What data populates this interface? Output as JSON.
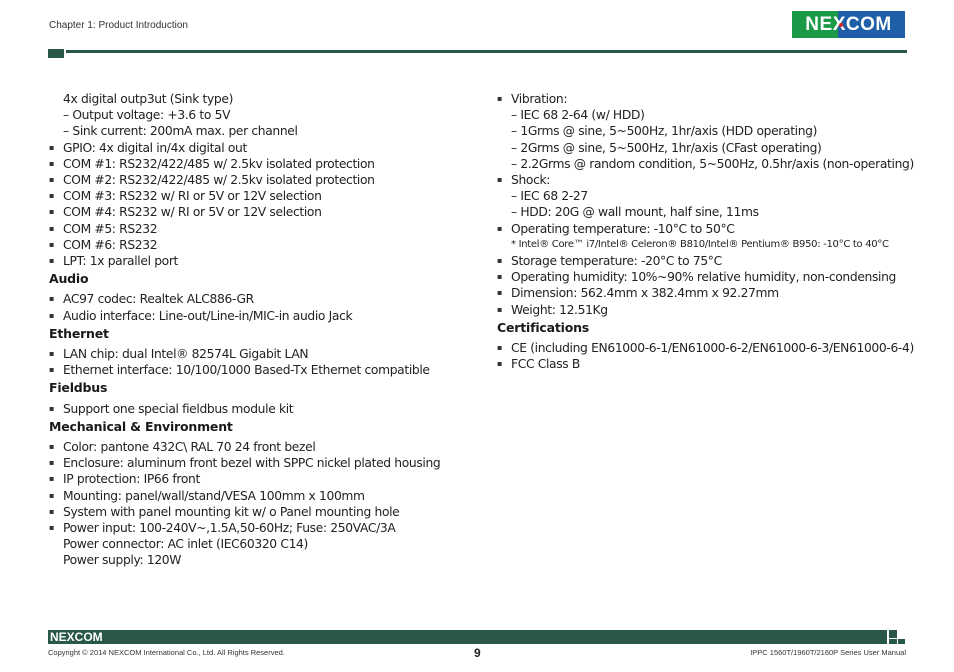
{
  "header": {
    "chapter": "Chapter 1: Product Introduction",
    "logo_text": "NEXCOM",
    "brand_colors": {
      "green": "#1a9a47",
      "blue": "#1f5fa8",
      "dark_green": "#2a5848",
      "red": "#e3262b"
    }
  },
  "left_column": {
    "io_lines": [
      {
        "type": "plain",
        "text": "4x digital outp3ut (Sink type)"
      },
      {
        "type": "dash",
        "text": "– Output voltage: +3.6 to 5V"
      },
      {
        "type": "dash",
        "text": "– Sink current: 200mA max. per channel"
      },
      {
        "type": "bullet",
        "text": "GPIO: 4x digital in/4x digital out"
      },
      {
        "type": "bullet",
        "text": "COM #1: RS232/422/485 w/ 2.5kv isolated protection"
      },
      {
        "type": "bullet",
        "text": "COM #2: RS232/422/485 w/ 2.5kv isolated protection"
      },
      {
        "type": "bullet",
        "text": "COM #3: RS232 w/ RI or 5V or 12V selection"
      },
      {
        "type": "bullet",
        "text": "COM #4: RS232 w/ RI or 5V or 12V selection"
      },
      {
        "type": "bullet",
        "text": "COM #5: RS232"
      },
      {
        "type": "bullet",
        "text": "COM #6: RS232"
      },
      {
        "type": "bullet",
        "text": "LPT: 1x parallel port"
      }
    ],
    "audio": {
      "heading": "Audio",
      "items": [
        "AC97 codec: Realtek ALC886-GR",
        "Audio interface: Line-out/Line-in/MIC-in audio Jack"
      ]
    },
    "ethernet": {
      "heading": "Ethernet",
      "items": [
        "LAN chip: dual Intel® 82574L Gigabit LAN",
        "Ethernet interface: 10/100/1000 Based-Tx Ethernet compatible"
      ]
    },
    "fieldbus": {
      "heading": "Fieldbus",
      "items": [
        "Support one special fieldbus module kit"
      ]
    },
    "mechanical": {
      "heading": "Mechanical & Environment",
      "items": [
        "Color: pantone 432C\\ RAL 70 24 front bezel",
        "Enclosure: aluminum front bezel with SPPC nickel plated housing",
        "IP protection: IP66 front",
        "Mounting: panel/wall/stand/VESA 100mm x 100mm",
        "System with panel mounting kit w/ o Panel mounting hole",
        "Power input: 100-240V~,1.5A,50-60Hz; Fuse: 250VAC/3A"
      ],
      "continuation": [
        "Power connector: AC inlet (IEC60320 C14)",
        "Power supply: 120W"
      ]
    }
  },
  "right_column": {
    "env_lines": [
      {
        "type": "bullet",
        "text": "Vibration:"
      },
      {
        "type": "dash",
        "text": "– IEC 68 2-64 (w/ HDD)"
      },
      {
        "type": "dash",
        "text": "– 1Grms @ sine, 5~500Hz, 1hr/axis (HDD operating)"
      },
      {
        "type": "dash",
        "text": "– 2Grms @ sine, 5~500Hz, 1hr/axis (CFast operating)"
      },
      {
        "type": "dash",
        "text": "– 2.2Grms @ random condition, 5~500Hz, 0.5hr/axis (non-operating)"
      },
      {
        "type": "bullet",
        "text": "Shock:"
      },
      {
        "type": "dash",
        "text": "– IEC 68 2-27"
      },
      {
        "type": "dash",
        "text": "– HDD: 20G @ wall mount, half sine, 11ms"
      },
      {
        "type": "bullet",
        "text": "Operating temperature: -10°C to 50°C"
      },
      {
        "type": "note",
        "text": "* Intel® Core™ i7/Intel® Celeron® B810/Intel® Pentium® B950: -10°C to 40°C"
      },
      {
        "type": "bullet",
        "text": "Storage temperature: -20°C to 75°C"
      },
      {
        "type": "bullet",
        "text": "Operating humidity: 10%~90% relative humidity, non-condensing"
      },
      {
        "type": "bullet",
        "text": "Dimension: 562.4mm x 382.4mm x 92.27mm"
      },
      {
        "type": "bullet",
        "text": "Weight: 12.51Kg"
      }
    ],
    "certifications": {
      "heading": "Certifications",
      "items": [
        "CE (including EN61000-6-1/EN61000-6-2/EN61000-6-3/EN61000-6-4)",
        "FCC Class B"
      ]
    }
  },
  "footer": {
    "logo_text": "NEXCOM",
    "copyright": "Copyright © 2014 NEXCOM International Co., Ltd. All Rights Reserved.",
    "page_number": "9",
    "manual_title": "IPPC 1560T/1960T/2160P Series User Manual"
  }
}
